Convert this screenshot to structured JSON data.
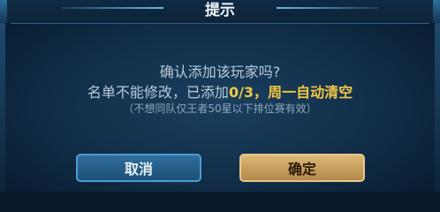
{
  "dialog": {
    "title": "提示",
    "question": "确认添加该玩家吗?",
    "info": {
      "prefix": "名单不能修改，已添加",
      "count": "0/3",
      "separator": "，",
      "suffix": "周一自动清空"
    },
    "note": "（不想同队仅王者50星以下排位赛有效）",
    "buttons": {
      "cancel": "取消",
      "confirm": "确定"
    }
  },
  "colors": {
    "highlight": "#f2c744",
    "panel": "#12304b",
    "confirm_button": "#c9a15e",
    "cancel_button": "#2a6290"
  }
}
